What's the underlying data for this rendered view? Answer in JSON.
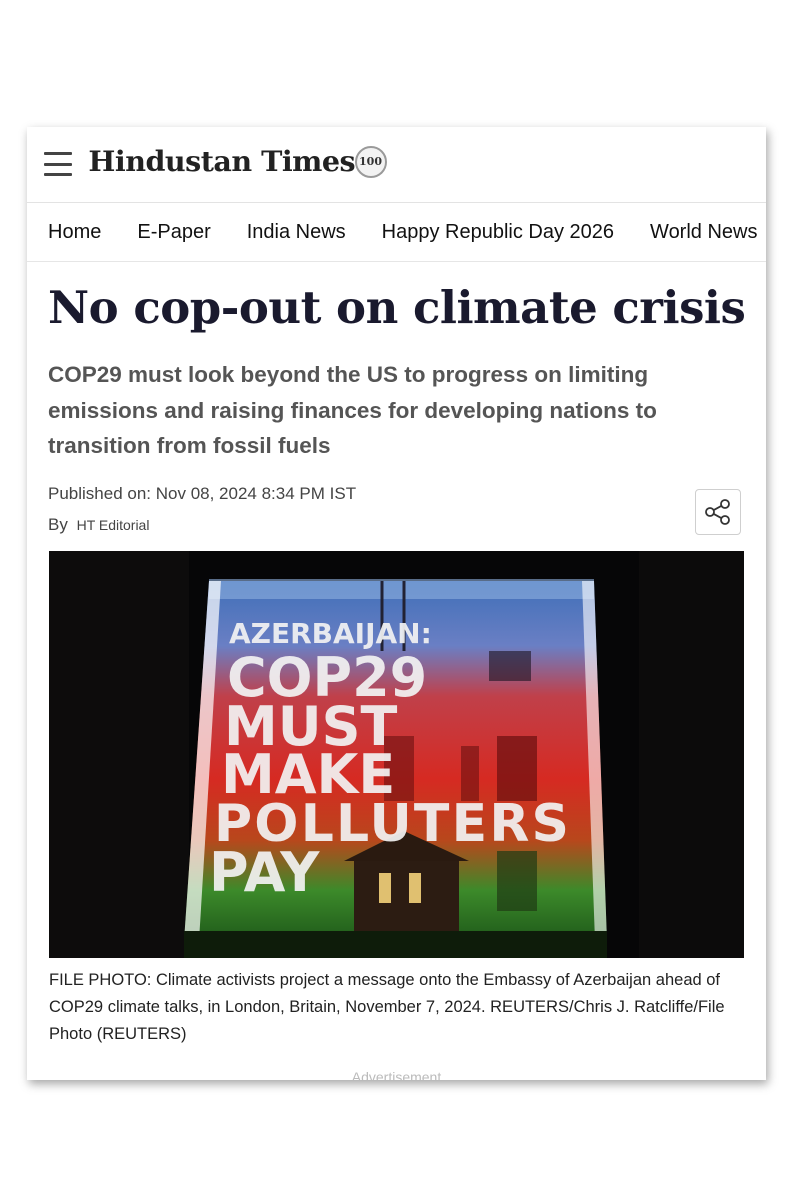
{
  "header": {
    "logo_text": "Hindustan Times",
    "logo_badge": "100"
  },
  "nav": {
    "items": [
      {
        "label": "Home"
      },
      {
        "label": "E-Paper"
      },
      {
        "label": "India News"
      },
      {
        "label": "Happy Republic Day 2026"
      },
      {
        "label": "World News"
      }
    ]
  },
  "article": {
    "headline": "No cop-out on climate crisis",
    "summary": "COP29 must look beyond the US to progress on limiting emissions and raising finances for developing nations to transition from fossil fuels",
    "published": "Published on: Nov 08, 2024 8:34 PM IST",
    "by_label": "By",
    "author": "HT Editorial",
    "photo": {
      "projected_lines": [
        "AZERBAIJAN:",
        "COP29",
        "MUST",
        "MAKE",
        "POLLUTERS",
        "PAY"
      ]
    },
    "caption": "FILE PHOTO: Climate activists project a message onto the Embassy of Azerbaijan ahead of COP29 climate talks, in London, Britain, November 7, 2024. REUTERS/Chris J. Ratcliffe/File Photo (REUTERS)"
  },
  "advertisement_label": "Advertisement",
  "icons": {
    "menu": "hamburger-menu-icon",
    "share": "share-icon"
  }
}
